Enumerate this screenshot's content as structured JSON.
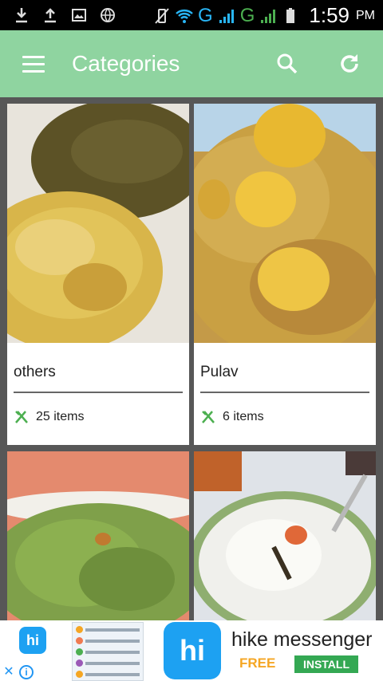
{
  "status_bar": {
    "carrier_1": "G",
    "carrier_2": "G",
    "time": "1:59",
    "ampm": "PM"
  },
  "app_bar": {
    "title": "Categories",
    "menu_icon": "hamburger-icon",
    "search_icon": "search-icon",
    "refresh_icon": "refresh-icon"
  },
  "categories": [
    {
      "name": "others",
      "count_label": "25 items",
      "image": "rice-and-greens"
    },
    {
      "name": "Pulav",
      "count_label": "6 items",
      "image": "potato-biryani"
    },
    {
      "name": "",
      "count_label": "",
      "image": "green-rice"
    },
    {
      "name": "",
      "count_label": "",
      "image": "curd-rice"
    }
  ],
  "ad": {
    "brand_short": "hi",
    "brand_label": "hike",
    "name": "hike messenger",
    "price": "FREE",
    "cta": "INSTALL"
  },
  "colors": {
    "app_bar": "#8fd4a0",
    "background": "#575757",
    "accent": "#4caf50"
  }
}
